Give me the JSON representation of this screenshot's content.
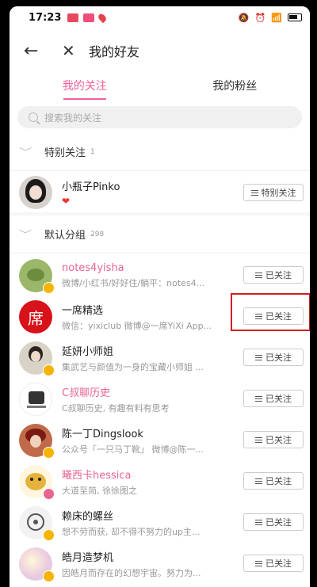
{
  "status": {
    "time": "17:23"
  },
  "header": {
    "title": "我的好友"
  },
  "tabs": [
    {
      "label": "我的关注"
    },
    {
      "label": "我的粉丝"
    }
  ],
  "search": {
    "placeholder": "搜索我的关注"
  },
  "special_group": {
    "title": "特别关注",
    "count": "1",
    "items": [
      {
        "name": "小瓶子Pinko",
        "subtitle": "❤",
        "button": "特别关注"
      }
    ]
  },
  "default_group": {
    "title": "默认分组",
    "count": "298",
    "items": [
      {
        "name": "notes4yisha",
        "subtitle": "微博/小红书/好好住/躺平：notes4...",
        "button": "已关注",
        "avatar_color": "#9bb86a"
      },
      {
        "name": "一席精选",
        "subtitle": "微信：yixiclub 微博@一席YiXi App...",
        "button": "已关注",
        "avatar_color": "#d8121a"
      },
      {
        "name": "延妍小师姐",
        "subtitle": "集武艺与颜值为一身的宝藏小师姐 ...",
        "button": "已关注",
        "avatar_color": "#b09a85"
      },
      {
        "name": "C叔聊历史",
        "subtitle": "C叔聊历史, 有趣有料有思考",
        "button": "已关注",
        "avatar_color": "#555555"
      },
      {
        "name": "陈一丁Dingslook",
        "subtitle": "公众号「一只马丁靴」 微博@陈一...",
        "button": "已关注",
        "avatar_color": "#a04030"
      },
      {
        "name": "曦西卡hessica",
        "subtitle": "大道至简, 徐徐图之",
        "button": "已关注",
        "avatar_color": "#e0b040"
      },
      {
        "name": "赖床的螺丝",
        "subtitle": "想不劳而获, 却不得不努力的up主...",
        "button": "已关注",
        "avatar_color": "#999999"
      },
      {
        "name": "皓月造梦机",
        "subtitle": "因皓月而存在的幻想宇宙。努力为...",
        "button": "已关注",
        "avatar_color": "#e8d0e0"
      }
    ]
  },
  "colors": {
    "accent": "#f0609a",
    "highlight": "#d02020"
  }
}
